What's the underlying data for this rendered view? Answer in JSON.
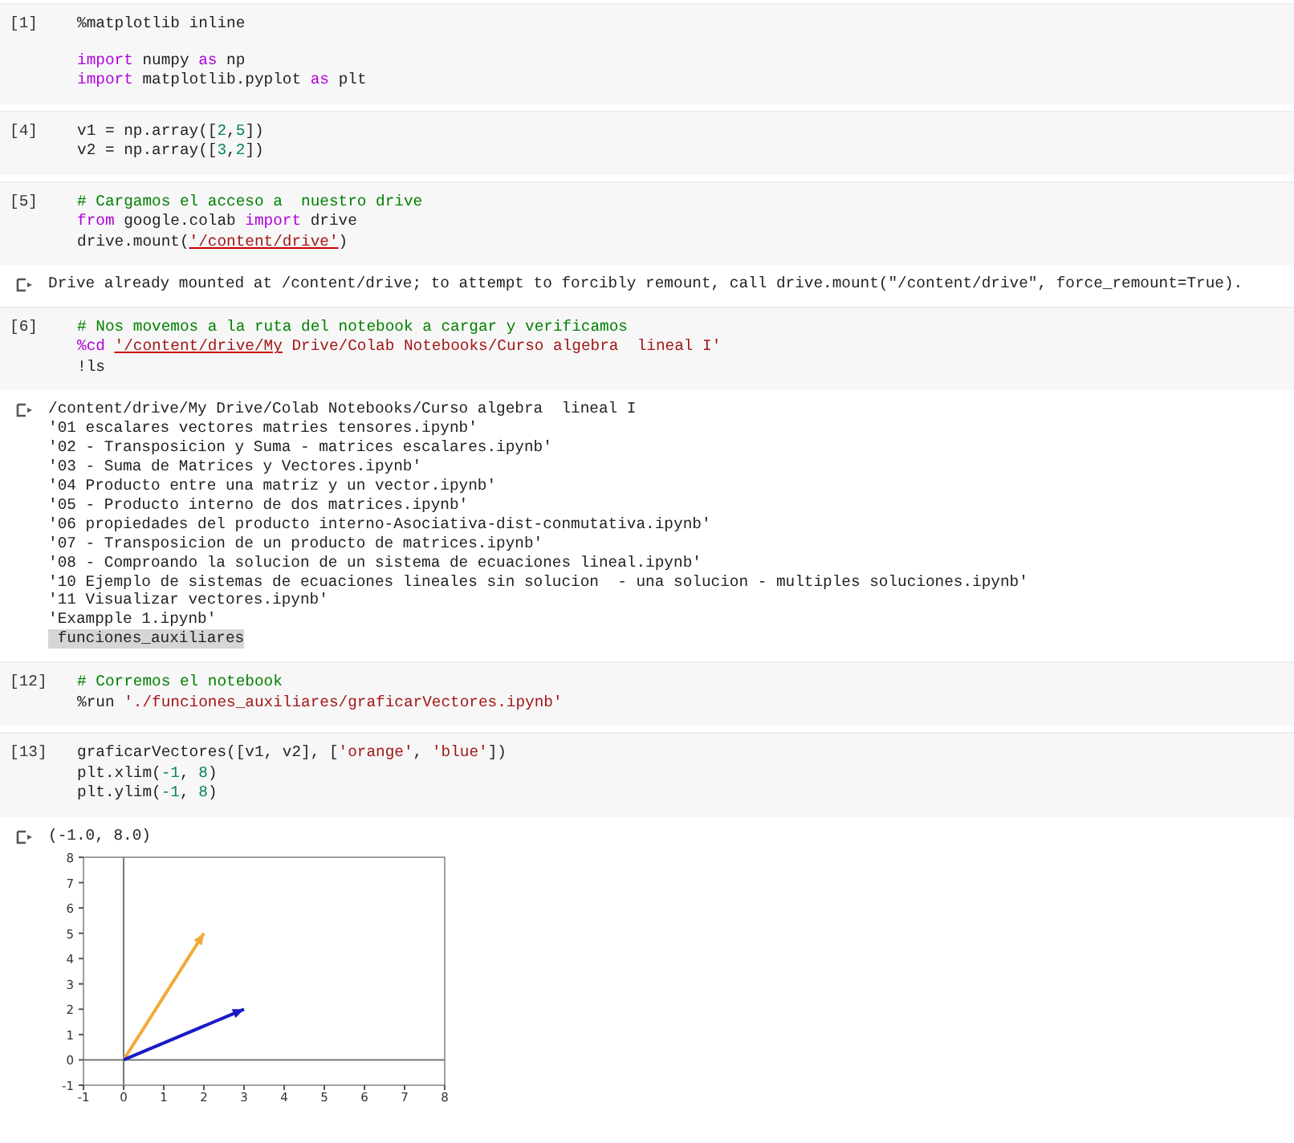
{
  "cells": [
    {
      "kind": "code",
      "prompt": "[1]",
      "blocks": [
        [
          [
            {
              "text": "%matplotlib inline",
              "kind": "plain"
            }
          ]
        ],
        [
          [
            {
              "text": "import",
              "kind": "keyword"
            },
            {
              "text": " numpy ",
              "kind": "plain"
            },
            {
              "text": "as",
              "kind": "keyword"
            },
            {
              "text": " np",
              "kind": "plain"
            }
          ],
          [
            {
              "text": "import",
              "kind": "keyword"
            },
            {
              "text": " matplotlib.pyplot ",
              "kind": "plain"
            },
            {
              "text": "as",
              "kind": "keyword"
            },
            {
              "text": " plt",
              "kind": "plain"
            }
          ]
        ]
      ]
    },
    {
      "kind": "code",
      "prompt": "[4]",
      "blocks": [
        [
          [
            {
              "text": "v1 = np.array([",
              "kind": "plain"
            },
            {
              "text": "2",
              "kind": "number"
            },
            {
              "text": ",",
              "kind": "plain"
            },
            {
              "text": "5",
              "kind": "number"
            },
            {
              "text": "])",
              "kind": "plain"
            }
          ],
          [
            {
              "text": "v2 = np.array([",
              "kind": "plain"
            },
            {
              "text": "3",
              "kind": "number"
            },
            {
              "text": ",",
              "kind": "plain"
            },
            {
              "text": "2",
              "kind": "number"
            },
            {
              "text": "])",
              "kind": "plain"
            }
          ]
        ]
      ]
    },
    {
      "kind": "code",
      "prompt": "[5]",
      "blocks": [
        [
          [
            {
              "text": "# Cargamos el acceso a  nuestro drive",
              "kind": "comment"
            }
          ],
          [
            {
              "text": "from",
              "kind": "keyword"
            },
            {
              "text": " google.colab ",
              "kind": "plain"
            },
            {
              "text": "import",
              "kind": "keyword"
            },
            {
              "text": " drive",
              "kind": "plain"
            }
          ],
          [
            {
              "text": "drive.mount(",
              "kind": "plain"
            },
            {
              "text": "'/content/drive'",
              "kind": "link"
            },
            {
              "text": ")",
              "kind": "plain"
            }
          ]
        ]
      ]
    },
    {
      "kind": "output",
      "lines": [
        {
          "text": "Drive already mounted at /content/drive; to attempt to forcibly remount, call drive.mount(\"/content/drive\", force_remount=True).",
          "highlighted": false
        }
      ]
    },
    {
      "kind": "code",
      "prompt": "[6]",
      "blocks": [
        [
          [
            {
              "text": "# Nos movemos a la ruta del notebook a cargar y verificamos",
              "kind": "comment"
            }
          ],
          [
            {
              "text": "%cd ",
              "kind": "keyword"
            },
            {
              "text": "'/content/drive/My",
              "kind": "link"
            },
            {
              "text": " Drive/Colab Notebooks/Curso algebra  lineal I'",
              "kind": "string"
            }
          ],
          [
            {
              "text": "!ls",
              "kind": "plain"
            }
          ]
        ]
      ]
    },
    {
      "kind": "output",
      "lines": [
        {
          "text": "/content/drive/My Drive/Colab Notebooks/Curso algebra  lineal I",
          "highlighted": false
        },
        {
          "text": "'01 escalares vectores matries tensores.ipynb'",
          "highlighted": false
        },
        {
          "text": "'02 - Transposicion y Suma - matrices escalares.ipynb'",
          "highlighted": false
        },
        {
          "text": "'03 - Suma de Matrices y Vectores.ipynb'",
          "highlighted": false
        },
        {
          "text": "'04 Producto entre una matriz y un vector.ipynb'",
          "highlighted": false
        },
        {
          "text": "'05 - Producto interno de dos matrices.ipynb'",
          "highlighted": false
        },
        {
          "text": "'06 propiedades del producto interno-Asociativa-dist-conmutativa.ipynb'",
          "highlighted": false
        },
        {
          "text": "'07 - Transposicion de un producto de matrices.ipynb'",
          "highlighted": false
        },
        {
          "text": "'08 - Comproando la solucion de un sistema de ecuaciones lineal.ipynb'",
          "highlighted": false
        },
        {
          "text": "'10 Ejemplo de sistemas de ecuaciones lineales sin solucion  - una solucion - multiples soluciones.ipynb'",
          "highlighted": false
        },
        {
          "text": "'11 Visualizar vectores.ipynb'",
          "highlighted": false
        },
        {
          "text": "'Exampple 1.ipynb'",
          "highlighted": false
        },
        {
          "text": " funciones_auxiliares",
          "highlighted": true
        }
      ]
    },
    {
      "kind": "code",
      "prompt": "[12]",
      "blocks": [
        [
          [
            {
              "text": "# Corremos el notebook",
              "kind": "comment"
            }
          ],
          [
            {
              "text": "%run ",
              "kind": "plain"
            },
            {
              "text": "'./funciones_auxiliares/graficarVectores.ipynb'",
              "kind": "string"
            }
          ]
        ]
      ]
    },
    {
      "kind": "code",
      "prompt": "[13]",
      "blocks": [
        [
          [
            {
              "text": "graficarVectores([v1, v2], [",
              "kind": "plain"
            },
            {
              "text": "'orange'",
              "kind": "string"
            },
            {
              "text": ", ",
              "kind": "plain"
            },
            {
              "text": "'blue'",
              "kind": "string"
            },
            {
              "text": "])",
              "kind": "plain"
            }
          ],
          [
            {
              "text": "plt.xlim(",
              "kind": "plain"
            },
            {
              "text": "-1",
              "kind": "number"
            },
            {
              "text": ", ",
              "kind": "plain"
            },
            {
              "text": "8",
              "kind": "number"
            },
            {
              "text": ")",
              "kind": "plain"
            }
          ],
          [
            {
              "text": "plt.ylim(",
              "kind": "plain"
            },
            {
              "text": "-1",
              "kind": "number"
            },
            {
              "text": ", ",
              "kind": "plain"
            },
            {
              "text": "8",
              "kind": "number"
            },
            {
              "text": ")",
              "kind": "plain"
            }
          ]
        ]
      ]
    },
    {
      "kind": "output",
      "lines": [
        {
          "text": "(-1.0, 8.0)",
          "highlighted": false
        }
      ],
      "chart_data": {
        "type": "line",
        "x": [
          0,
          2,
          3
        ],
        "series": [
          {
            "color": "#f2a93b",
            "values": [
              0,
              5,
              null
            ]
          },
          {
            "color": "#1a1ac8",
            "values": [
              0,
              null,
              2
            ]
          }
        ],
        "xlim": [
          -1,
          8
        ],
        "ylim": [
          -1,
          8
        ],
        "xticks": [
          -1,
          0,
          1,
          2,
          3,
          4,
          5,
          6,
          7,
          8
        ],
        "yticks": [
          -1,
          0,
          1,
          2,
          3,
          4,
          5,
          6,
          7,
          8
        ]
      }
    }
  ]
}
